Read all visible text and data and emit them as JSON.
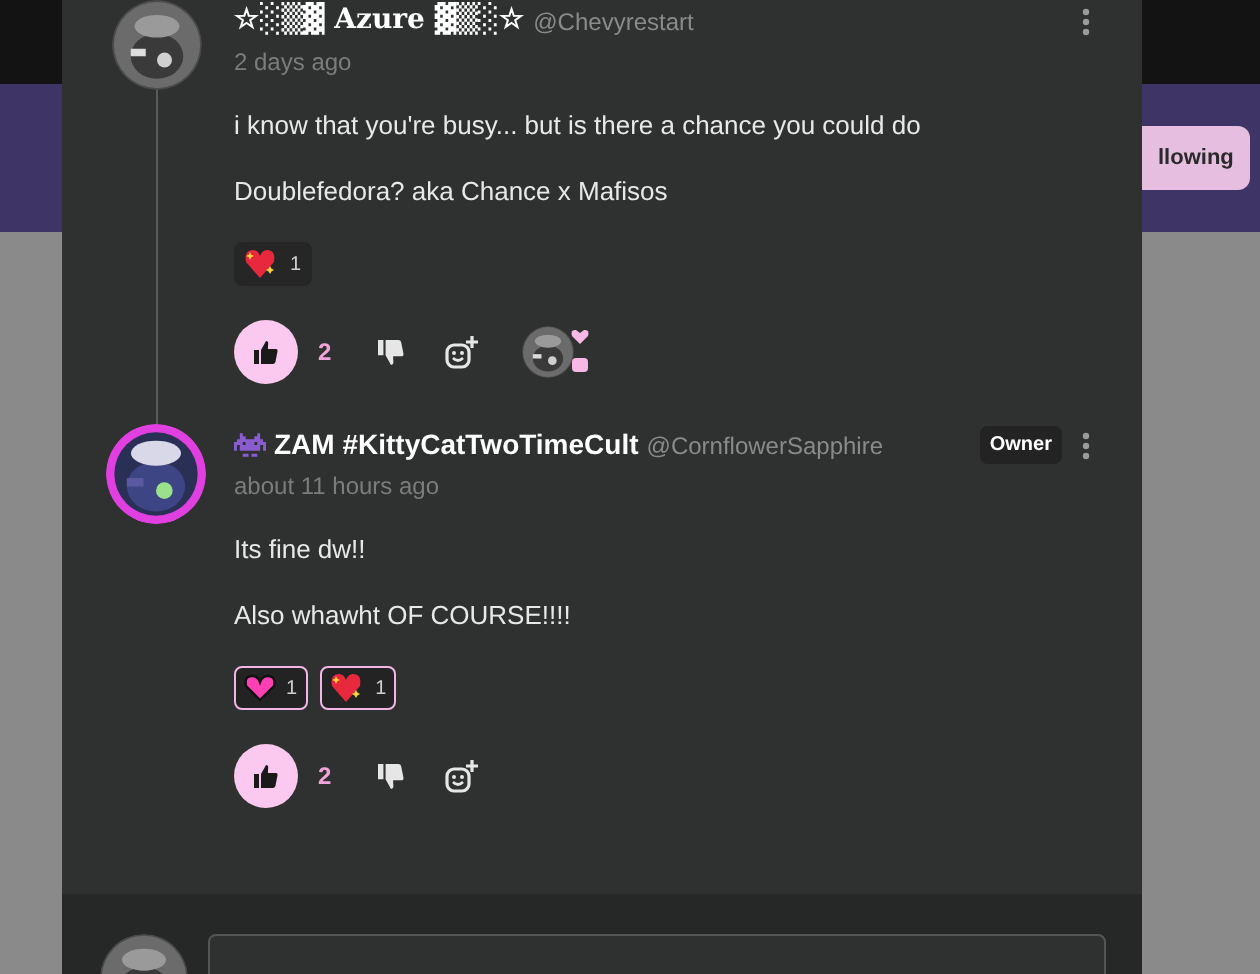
{
  "backdrop": {
    "follow_button": "llowing"
  },
  "comments": [
    {
      "kind": "member",
      "author": "☆░▒▓ Azure ▓▒░☆",
      "handle": "@Chevyrestart",
      "time": "2 days ago",
      "paragraphs": [
        "i know that you're busy... but  is there a chance you could do",
        "Doublefedora? aka Chance x Mafisos"
      ],
      "reactions": [
        {
          "kind": "sparkle-heart",
          "count": "1",
          "selected": false
        }
      ],
      "likes": "2",
      "liked": true,
      "has_replies": true
    },
    {
      "kind": "owner",
      "author": "ZAM #KittyCatTwoTimeCult",
      "handle": "@CornflowerSapphire",
      "badge": "Owner",
      "time": "about 11 hours ago",
      "paragraphs": [
        "Its fine dw!!",
        "Also whawht OF COURSE!!!!"
      ],
      "reactions": [
        {
          "kind": "pink-heart",
          "count": "1",
          "selected": true
        },
        {
          "kind": "sparkle-heart",
          "count": "1",
          "selected": true
        }
      ],
      "likes": "2",
      "liked": true,
      "has_replies": false
    }
  ]
}
